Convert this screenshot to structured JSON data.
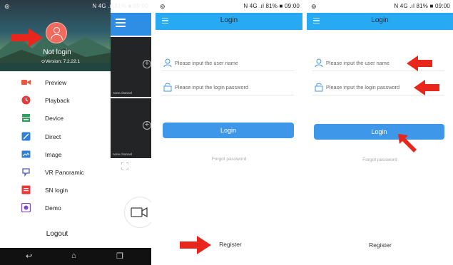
{
  "status": {
    "left_icon": "q-icon",
    "right_text": "N 4G .ıl 81% ■ 09:00"
  },
  "drawer": {
    "not_login": "Not login",
    "version": "Version: 7.2.22.1",
    "menu": [
      {
        "label": "Preview",
        "icon": "camera-icon",
        "color": "#e9573f"
      },
      {
        "label": "Playback",
        "icon": "clock-icon",
        "color": "#e63a3a"
      },
      {
        "label": "Device",
        "icon": "device-icon",
        "color": "#2ca35a"
      },
      {
        "label": "Direct",
        "icon": "link-icon",
        "color": "#2f7fd6"
      },
      {
        "label": "Image",
        "icon": "image-icon",
        "color": "#2f7fd6"
      },
      {
        "label": "VR Panoramic",
        "icon": "vr-icon",
        "color": "#4a5ab8"
      },
      {
        "label": "SN login",
        "icon": "sn-icon",
        "color": "#e63a3a"
      },
      {
        "label": "Demo",
        "icon": "demo-icon",
        "color": "#7c4ac9"
      }
    ],
    "logout": "Logout",
    "video_channel_1": "none.channel",
    "video_channel_2": "none.channel"
  },
  "login": {
    "title": "Login",
    "username_placeholder": "Please input the user name",
    "password_placeholder": "Please input the login password",
    "login_button": "Login",
    "forgot_password": "Forgot password",
    "register": "Register"
  },
  "colors": {
    "topbar": "#28aaf2",
    "button": "#3f97ea",
    "arrow": "#e8261b"
  }
}
